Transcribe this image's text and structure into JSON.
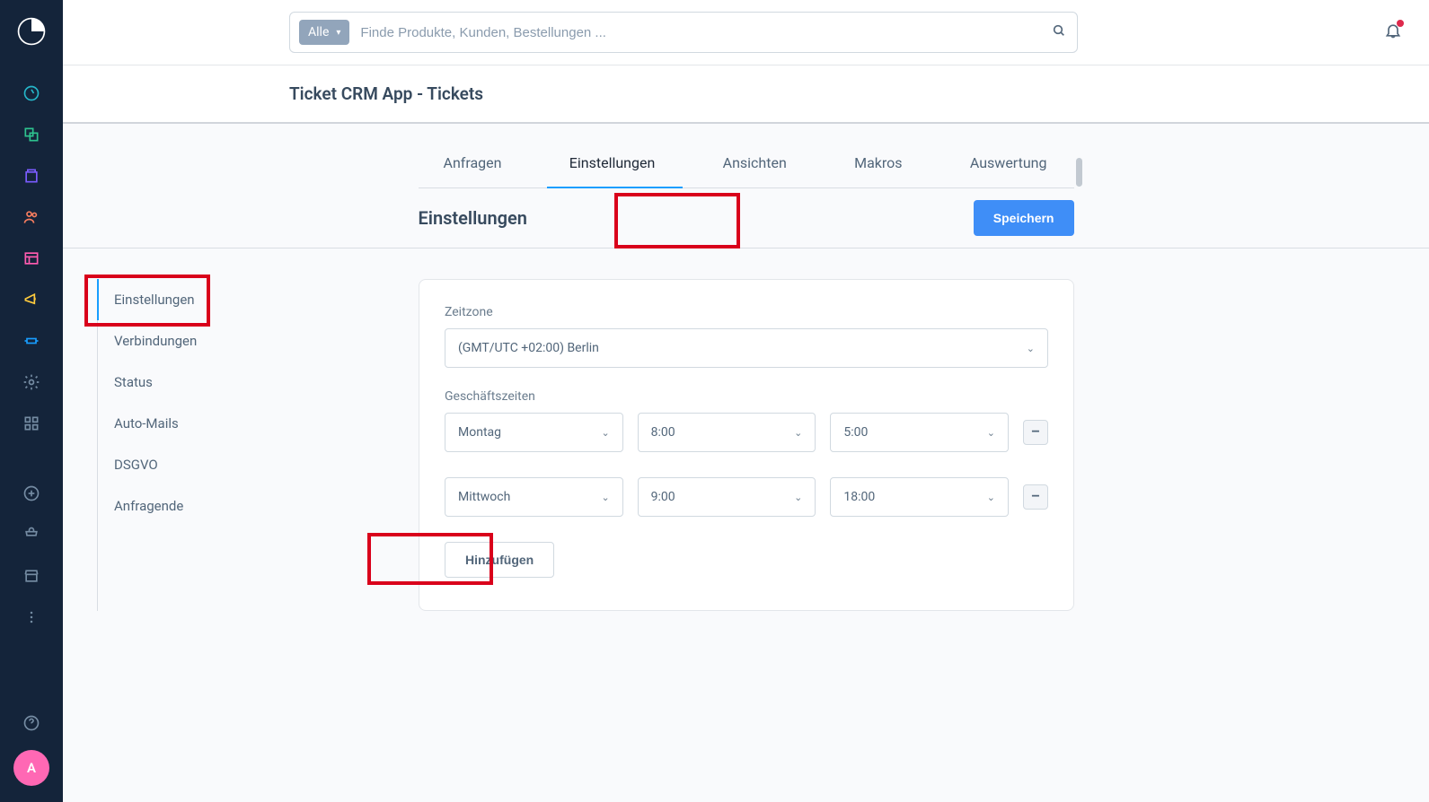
{
  "search": {
    "filter_label": "Alle",
    "placeholder": "Finde Produkte, Kunden, Bestellungen ..."
  },
  "page_title": "Ticket CRM App - Tickets",
  "tabs": {
    "requests": "Anfragen",
    "settings": "Einstellungen",
    "views": "Ansichten",
    "macros": "Makros",
    "reports": "Auswertung"
  },
  "subheader": {
    "title": "Einstellungen",
    "save_label": "Speichern"
  },
  "settings_nav": {
    "items": [
      "Einstellungen",
      "Verbindungen",
      "Status",
      "Auto-Mails",
      "DSGVO",
      "Anfragende"
    ]
  },
  "form": {
    "timezone_label": "Zeitzone",
    "timezone_value": "(GMT/UTC +02:00) Berlin",
    "hours_label": "Geschäftszeiten",
    "rows": [
      {
        "day": "Montag",
        "from": "8:00",
        "to": "5:00"
      },
      {
        "day": "Mittwoch",
        "from": "9:00",
        "to": "18:00"
      }
    ],
    "add_label": "Hinzufügen"
  },
  "avatar": {
    "initial": "A"
  }
}
